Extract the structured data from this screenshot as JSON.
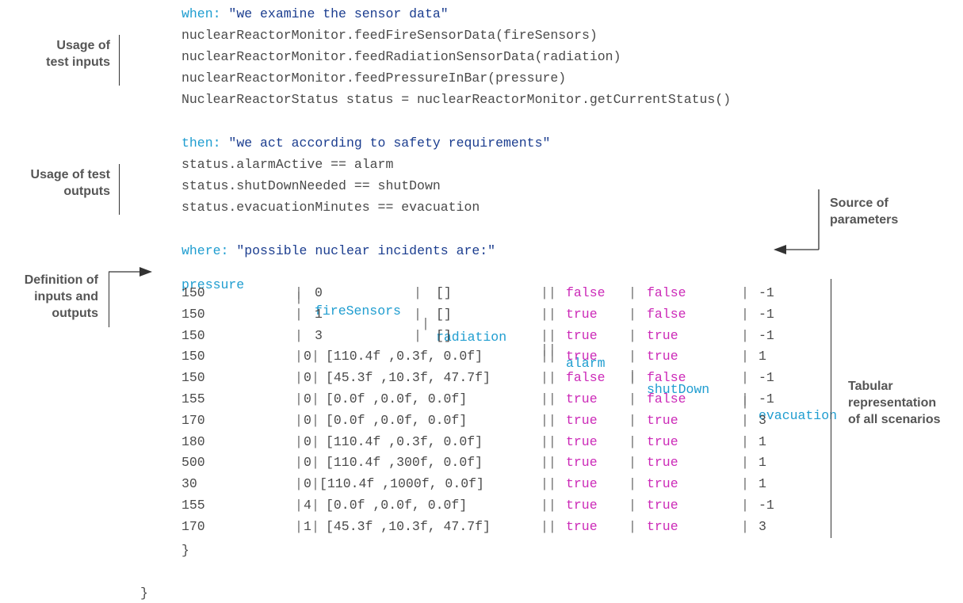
{
  "code": {
    "when_keyword": "when:",
    "when_string": "\"we examine the sensor data\"",
    "when_lines": [
      "nuclearReactorMonitor.feedFireSensorData(fireSensors)",
      "nuclearReactorMonitor.feedRadiationSensorData(radiation)",
      "nuclearReactorMonitor.feedPressureInBar(pressure)",
      "NuclearReactorStatus status = nuclearReactorMonitor.getCurrentStatus()"
    ],
    "then_keyword": "then:",
    "then_string": "\"we act according to safety requirements\"",
    "then_lines": [
      "status.alarmActive == alarm",
      "status.shutDownNeeded == shutDown",
      "status.evacuationMinutes == evacuation"
    ],
    "where_keyword": "where:",
    "where_string": "\"possible nuclear incidents are:\"",
    "table_header": {
      "pressure": "pressure",
      "fireSensors": "fireSensors",
      "radiation": "radiation",
      "alarm": "alarm",
      "shutDown": "shutDown",
      "evacuation": "evacuation"
    },
    "table_rows": [
      {
        "pressure": "150",
        "fire": "0",
        "radiation": "[]",
        "alarm": "false",
        "shutDown": "false",
        "evacuation": "-1"
      },
      {
        "pressure": "150",
        "fire": "1",
        "radiation": "[]",
        "alarm": "true",
        "shutDown": "false",
        "evacuation": "-1"
      },
      {
        "pressure": "150",
        "fire": "3",
        "radiation": "[]",
        "alarm": "true",
        "shutDown": "true",
        "evacuation": "-1"
      },
      {
        "pressure": "150",
        "fire": "0",
        "radiation": "[110.4f ,0.3f, 0.0f]",
        "alarm": "true",
        "shutDown": "true",
        "evacuation": "1"
      },
      {
        "pressure": "150",
        "fire": "0",
        "radiation": "[45.3f ,10.3f, 47.7f]",
        "alarm": "false",
        "shutDown": "false",
        "evacuation": "-1"
      },
      {
        "pressure": "155",
        "fire": "0",
        "radiation": "[0.0f ,0.0f, 0.0f]",
        "alarm": "true",
        "shutDown": "false",
        "evacuation": "-1"
      },
      {
        "pressure": "170",
        "fire": "0",
        "radiation": "[0.0f ,0.0f, 0.0f]",
        "alarm": "true",
        "shutDown": "true",
        "evacuation": "3"
      },
      {
        "pressure": "180",
        "fire": "0",
        "radiation": "[110.4f ,0.3f, 0.0f]",
        "alarm": "true",
        "shutDown": "true",
        "evacuation": "1"
      },
      {
        "pressure": "500",
        "fire": "0",
        "radiation": "[110.4f ,300f, 0.0f]",
        "alarm": "true",
        "shutDown": "true",
        "evacuation": "1"
      },
      {
        "pressure": "30",
        "fire": "0",
        "radiation": "[110.4f ,1000f, 0.0f]",
        "alarm": "true",
        "shutDown": "true",
        "evacuation": "1"
      },
      {
        "pressure": "155",
        "fire": "4",
        "radiation": "[0.0f ,0.0f, 0.0f]",
        "alarm": "true",
        "shutDown": "true",
        "evacuation": "-1"
      },
      {
        "pressure": "170",
        "fire": "1",
        "radiation": "[45.3f ,10.3f, 47.7f]",
        "alarm": "true",
        "shutDown": "true",
        "evacuation": "3"
      }
    ],
    "inner_close_brace": "}",
    "outer_close_brace": "}"
  },
  "annotations": {
    "usage_inputs": [
      "Usage of",
      "test inputs"
    ],
    "usage_outputs": [
      "Usage of test",
      "outputs"
    ],
    "source_params": [
      "Source of",
      "parameters"
    ],
    "definition": [
      "Definition of",
      "inputs and",
      "outputs"
    ],
    "tabular": [
      "Tabular",
      "representation",
      "of all scenarios"
    ]
  },
  "colors": {
    "keyword": "#1f9dd0",
    "string": "#1b3d8f",
    "boolean": "#cc2ab8",
    "code_text": "#4a4a4a",
    "annotation": "#555555"
  }
}
